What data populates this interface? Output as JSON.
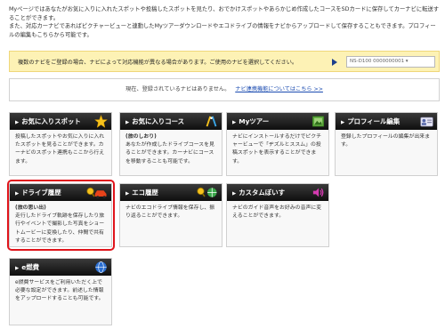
{
  "intro": {
    "line1": "Myページではあなたがお気に入りに入れたスポットや投稿したスポットを見たり、おでかけスポットやあらかじめ作成したコースをSDカードに保存してカーナビに転送することができます。",
    "line2": "また、対応カーナビであればピクチャービューと連動したMyツアーダウンロードやエコドライブの情報をナビからアップロードして保存することもできます。プロフィールの編集もこちらから可能です。"
  },
  "notice": {
    "text": "複数のナビをご登録の場合、ナビによって対応機能が異なる場合があります。ご使用のナビを選択してください。",
    "select_value": "NS-D100 0000000001 ▾"
  },
  "status": {
    "text": "現在、登録されているナビはありません。",
    "link": "ナビ連携機能についてはこちら >>"
  },
  "cards": {
    "fav_spot": {
      "title": "お気に入りスポット",
      "body": "投稿したスポットやお気に入りに入れたスポットを見ることができます。カーナビのスポット連携もここから行えます。",
      "icon": "star-icon"
    },
    "fav_course": {
      "title": "お気に入りコース",
      "subtitle": "(旅のしおり)",
      "body": "あなたが作成したドライブコースを見ることができます。カーナビにコースを移動することも可能です。",
      "icon": "route-icon"
    },
    "my_tour": {
      "title": "Myツアー",
      "body": "ナビにインストールするだけでピクチャービューで「ヂズルとススム」の投稿スポットを表示することができます。",
      "icon": "picture-icon"
    },
    "profile": {
      "title": "プロフィール編集",
      "body": "登録したプロフィールの編集が出来ます。",
      "icon": "profile-card-icon"
    },
    "drive_log": {
      "title": "ドライブ履歴",
      "subtitle": "(旅の思い出)",
      "body": "走行したドライブ軌跡を保存したり旅行やイベントで撮影した写真をショートムービーに変換したり、仲間で共有することができます。",
      "icon": "car-search-icon"
    },
    "eco_log": {
      "title": "エコ履歴",
      "body": "ナビのエコドライブ情報を保存し、振り返ることができます。",
      "icon": "eco-globe-icon"
    },
    "custom_voice": {
      "title": "カスタムぼいす",
      "body": "ナビのガイド音声をお好みの音声に変えることができます。",
      "icon": "speaker-icon"
    },
    "e_fuel": {
      "title": "e燃費",
      "body": "e燃費サービスをご利用いただく上で必要な設定ができます。前述した情報をアップロードすることも可能です。",
      "icon": "globe-icon"
    }
  },
  "colors": {
    "header_bg": "#1a1a1a",
    "highlight": "#e0141b",
    "notice_bg": "#fdf2b5",
    "link": "#1a4bb0"
  }
}
